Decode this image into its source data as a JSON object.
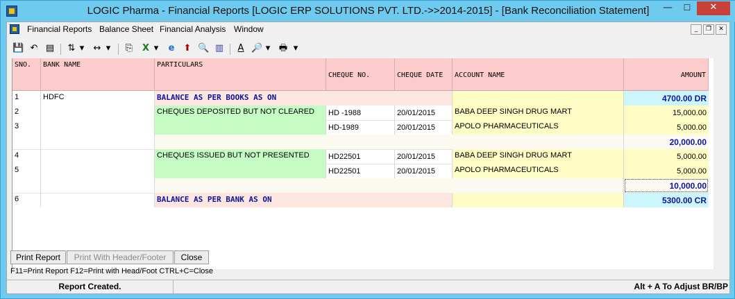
{
  "window": {
    "title": "LOGIC Pharma - Financial Reports  [LOGIC ERP SOLUTIONS PVT. LTD.->>2014-2015] - [Bank Reconciliation Statement]",
    "minimize": "—",
    "maximize": "☐",
    "close": "✕"
  },
  "menu": [
    "Financial Reports",
    "Balance Sheet",
    "Financial Analysis",
    "Window"
  ],
  "mdi_controls": [
    "_",
    "❐",
    "✕"
  ],
  "toolbar": {
    "icons": [
      "save-icon",
      "undo-icon",
      "calculator-icon",
      "sort-icon",
      "dropdown-icon",
      "column-width-icon",
      "dropdown-icon",
      "copy-icon",
      "excel-icon",
      "dropdown-icon",
      "browser-icon",
      "upload-arrow-icon",
      "find-icon",
      "chart-icon",
      "font-icon",
      "print-preview-icon",
      "dropdown-icon",
      "printer-icon",
      "dropdown-icon"
    ],
    "glyphs": [
      "💾",
      "↶",
      "▤",
      "⇅",
      "▾",
      "↔",
      "▾",
      "⎘",
      "X",
      "▾",
      "e",
      "⬆",
      "🔍",
      "▥",
      "A",
      "🔎",
      "▾",
      "🖶",
      "▾"
    ]
  },
  "grid": {
    "headers": [
      "SNO.",
      "BANK NAME",
      "PARTICULARS",
      "CHEQUE NO.",
      "CHEQUE DATE",
      "ACCOUNT NAME",
      "AMOUNT"
    ],
    "rows": [
      {
        "sno": "1",
        "bank": "HDFC",
        "particulars": "BALANCE AS PER BOOKS AS ON",
        "cheque_no": "",
        "cheque_date": "",
        "account": "",
        "amount": "4700.00 DR"
      },
      {
        "sno": "2",
        "bank": "",
        "particulars": "CHEQUES DEPOSITED BUT NOT CLEARED",
        "cheque_no": "HD -1988",
        "cheque_date": "20/01/2015",
        "account": "BABA DEEP SINGH DRUG MART",
        "amount": "15,000.00"
      },
      {
        "sno": "3",
        "bank": "",
        "particulars": "",
        "cheque_no": "HD-1989",
        "cheque_date": "20/01/2015",
        "account": "APOLO PHARMACEUTICALS",
        "amount": "5,000.00"
      },
      {
        "sno": "",
        "bank": "",
        "particulars": "",
        "cheque_no": "",
        "cheque_date": "",
        "account": "",
        "amount": "20,000.00"
      },
      {
        "sno": "4",
        "bank": "",
        "particulars": "CHEQUES ISSUED BUT NOT PRESENTED",
        "cheque_no": "HD22501",
        "cheque_date": "20/01/2015",
        "account": "BABA DEEP SINGH DRUG MART",
        "amount": "5,000.00"
      },
      {
        "sno": "5",
        "bank": "",
        "particulars": "",
        "cheque_no": "HD22501",
        "cheque_date": "20/01/2015",
        "account": "APOLO PHARMACEUTICALS",
        "amount": "5,000.00"
      },
      {
        "sno": "",
        "bank": "",
        "particulars": "",
        "cheque_no": "",
        "cheque_date": "",
        "account": "",
        "amount": "10,000.00"
      },
      {
        "sno": "6",
        "bank": "",
        "particulars": "BALANCE AS PER BANK AS ON",
        "cheque_no": "",
        "cheque_date": "",
        "account": "",
        "amount": "5300.00 CR"
      }
    ]
  },
  "buttons": {
    "print_report": "Print Report",
    "print_header_footer": "Print With Header/Footer",
    "close": "Close"
  },
  "shortcuts": "F11=Print Report  F12=Print with Head/Foot  CTRL+C=Close",
  "status": {
    "left": "Report Created.",
    "right": "Alt + A To Adjust BR/BP"
  },
  "colors": {
    "header": "#fccccc",
    "particulars_highlight": "#c4fcc4",
    "account_highlight": "#fdfcc4",
    "amount_highlight": "#ccf6fc",
    "balance_text": "#0a14a0"
  }
}
